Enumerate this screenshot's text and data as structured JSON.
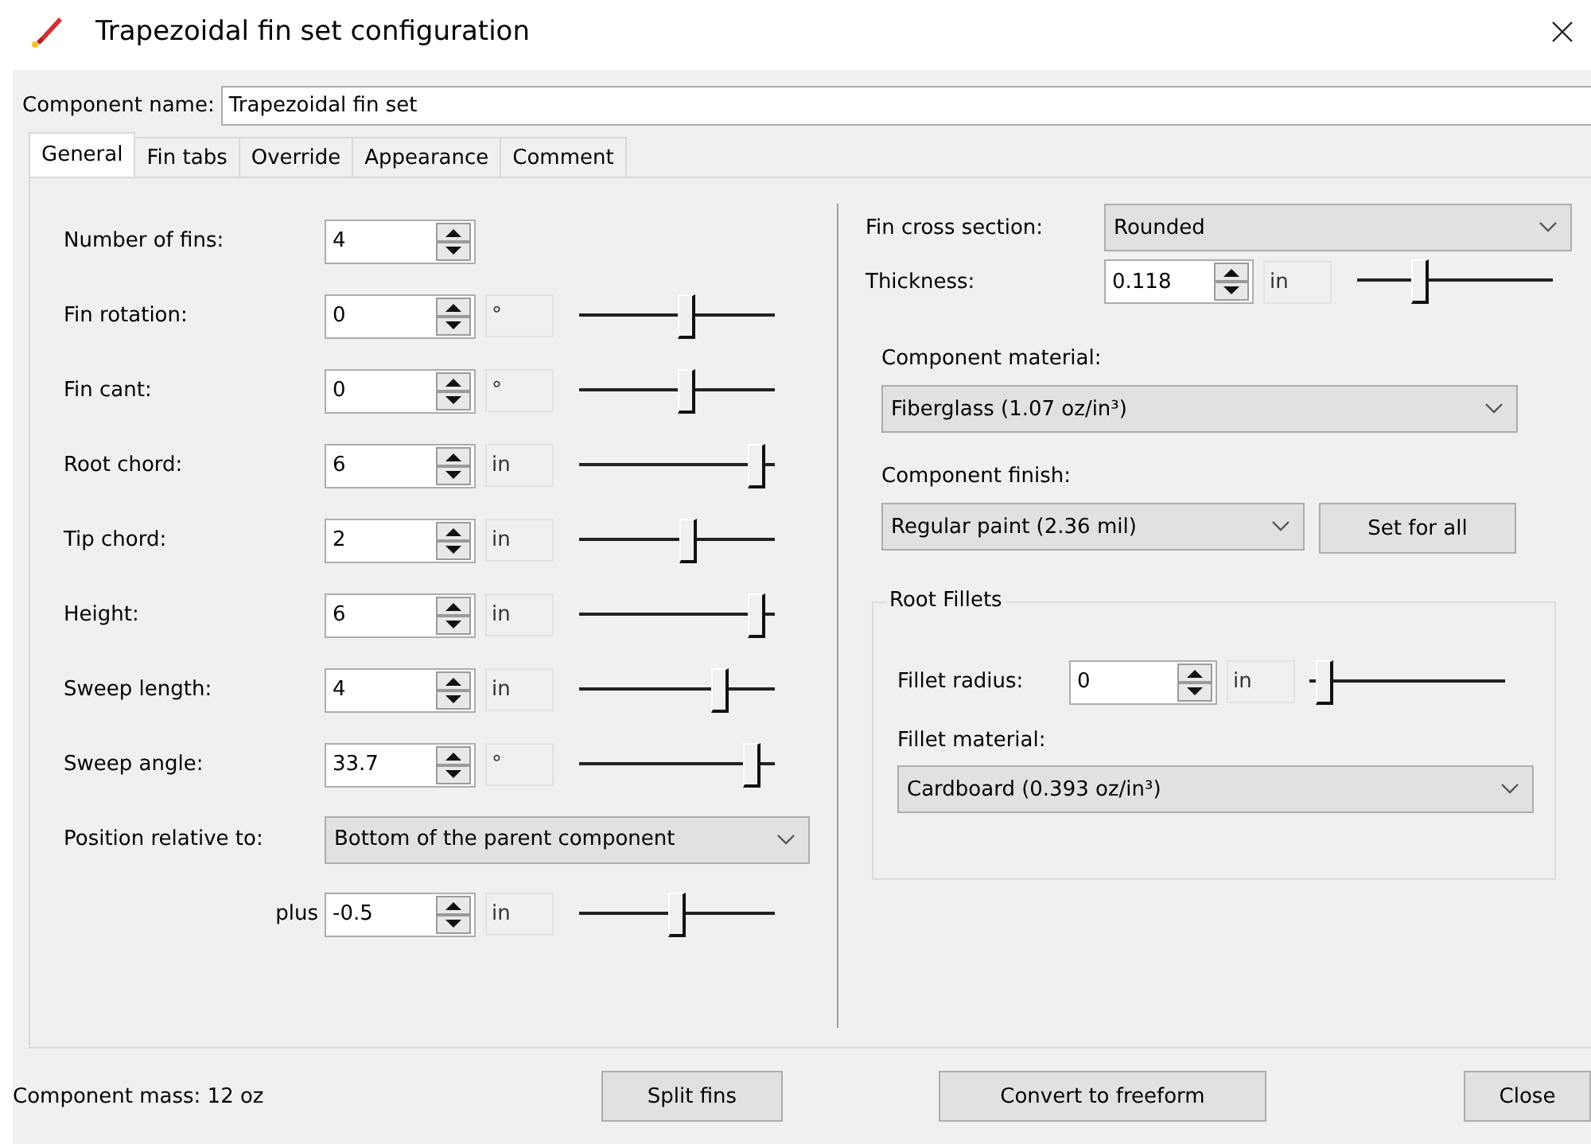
{
  "window": {
    "title": "Trapezoidal fin set configuration"
  },
  "component_name": {
    "label": "Component name:",
    "value": "Trapezoidal fin set"
  },
  "tabs": [
    {
      "label": "General",
      "selected": true
    },
    {
      "label": "Fin tabs",
      "selected": false
    },
    {
      "label": "Override",
      "selected": false
    },
    {
      "label": "Appearance",
      "selected": false
    },
    {
      "label": "Comment",
      "selected": false
    }
  ],
  "left": {
    "rows": [
      {
        "label": "Number of fins:",
        "value": "4"
      },
      {
        "label": "Fin rotation:",
        "value": "0",
        "unit": "°",
        "level": 0.55
      },
      {
        "label": "Fin cant:",
        "value": "0",
        "unit": "°",
        "level": 0.55
      },
      {
        "label": "Root chord:",
        "value": "6",
        "unit": "in",
        "level": 0.95
      },
      {
        "label": "Tip chord:",
        "value": "2",
        "unit": "in",
        "level": 0.56
      },
      {
        "label": "Height:",
        "value": "6",
        "unit": "in",
        "level": 0.95
      },
      {
        "label": "Sweep length:",
        "value": "4",
        "unit": "in",
        "level": 0.74
      },
      {
        "label": "Sweep angle:",
        "value": "33.7",
        "unit": "°",
        "level": 0.92
      }
    ],
    "position": {
      "label": "Position relative to:",
      "value": "Bottom of the parent component"
    },
    "plus": {
      "label": "plus",
      "value": "-0.5",
      "unit": "in",
      "level": 0.5
    }
  },
  "right": {
    "cross_section": {
      "label": "Fin cross section:",
      "value": "Rounded"
    },
    "thickness": {
      "label": "Thickness:",
      "value": "0.118",
      "unit": "in",
      "level": 0.3
    },
    "material": {
      "label": "Component material:",
      "value": "Fiberglass (1.07 oz/in³)"
    },
    "finish": {
      "label": "Component finish:",
      "value": "Regular paint (2.36 mil)",
      "button": "Set for all"
    },
    "root_fillets": {
      "title": "Root Fillets",
      "radius": {
        "label": "Fillet radius:",
        "value": "0",
        "unit": "in",
        "level": 0.04
      },
      "material": {
        "label": "Fillet material:",
        "value": "Cardboard (0.393 oz/in³)"
      }
    }
  },
  "footer": {
    "mass": "Component mass: 12 oz",
    "buttons": [
      "Split fins",
      "Convert to freeform",
      "Close"
    ]
  }
}
